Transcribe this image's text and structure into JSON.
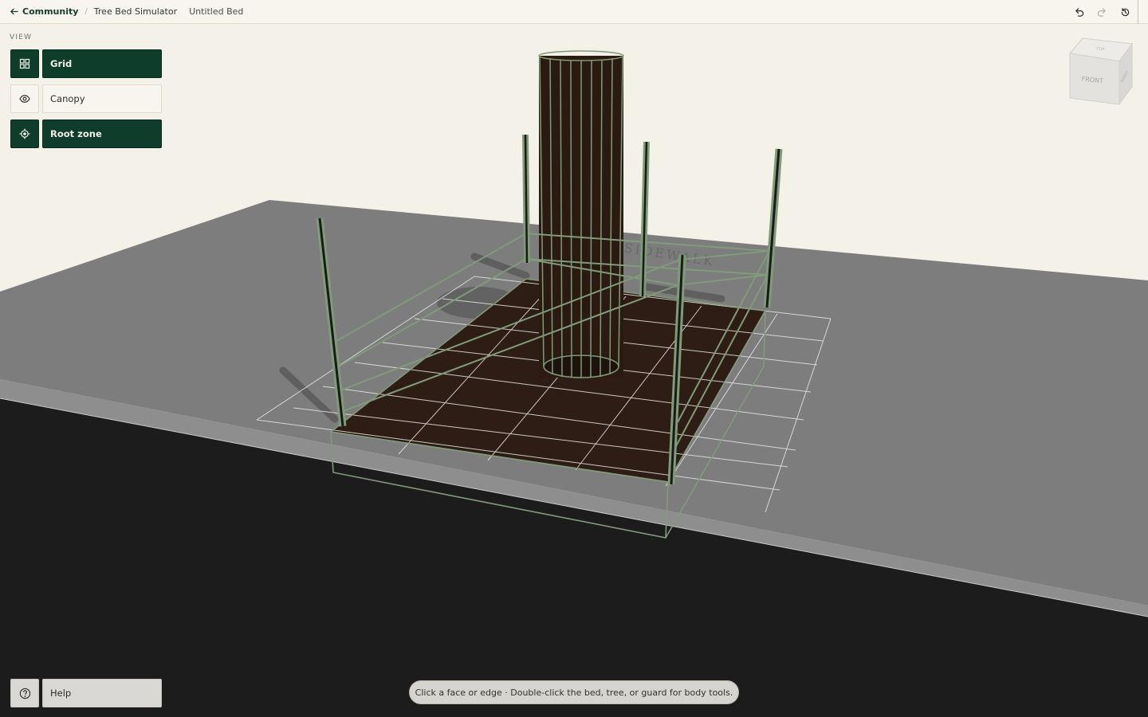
{
  "breadcrumb": {
    "back_label": "Community",
    "separator": "/",
    "app_name": "Tree Bed Simulator",
    "document_name": "Untitled Bed"
  },
  "toolbar": {
    "actions": [
      "undo-icon",
      "redo-icon",
      "history-icon"
    ]
  },
  "view_panel": {
    "section_label": "VIEW",
    "tools": [
      {
        "label": "Grid",
        "icon": "grid-icon",
        "active": true
      },
      {
        "label": "Canopy",
        "icon": "eye-icon",
        "active": false
      },
      {
        "label": "Root zone",
        "icon": "crosshair-icon",
        "active": true
      }
    ]
  },
  "navcube": {
    "front_label": "FRONT",
    "top_label": "TOP",
    "side_label": "RIGHT"
  },
  "scene": {
    "ground_label": "SIDEWALK"
  },
  "help": {
    "label": "Help"
  },
  "hint": {
    "text": "Click a face or edge · Double-click the bed, tree, or guard for body tools."
  },
  "colors": {
    "accent": "#0f3d2c",
    "guard_green": "#7f9c78",
    "soil": "#2e1d14",
    "sidewalk": "#7d7d7d",
    "street": "#1c1c1c",
    "background": "#f4f1e8"
  }
}
